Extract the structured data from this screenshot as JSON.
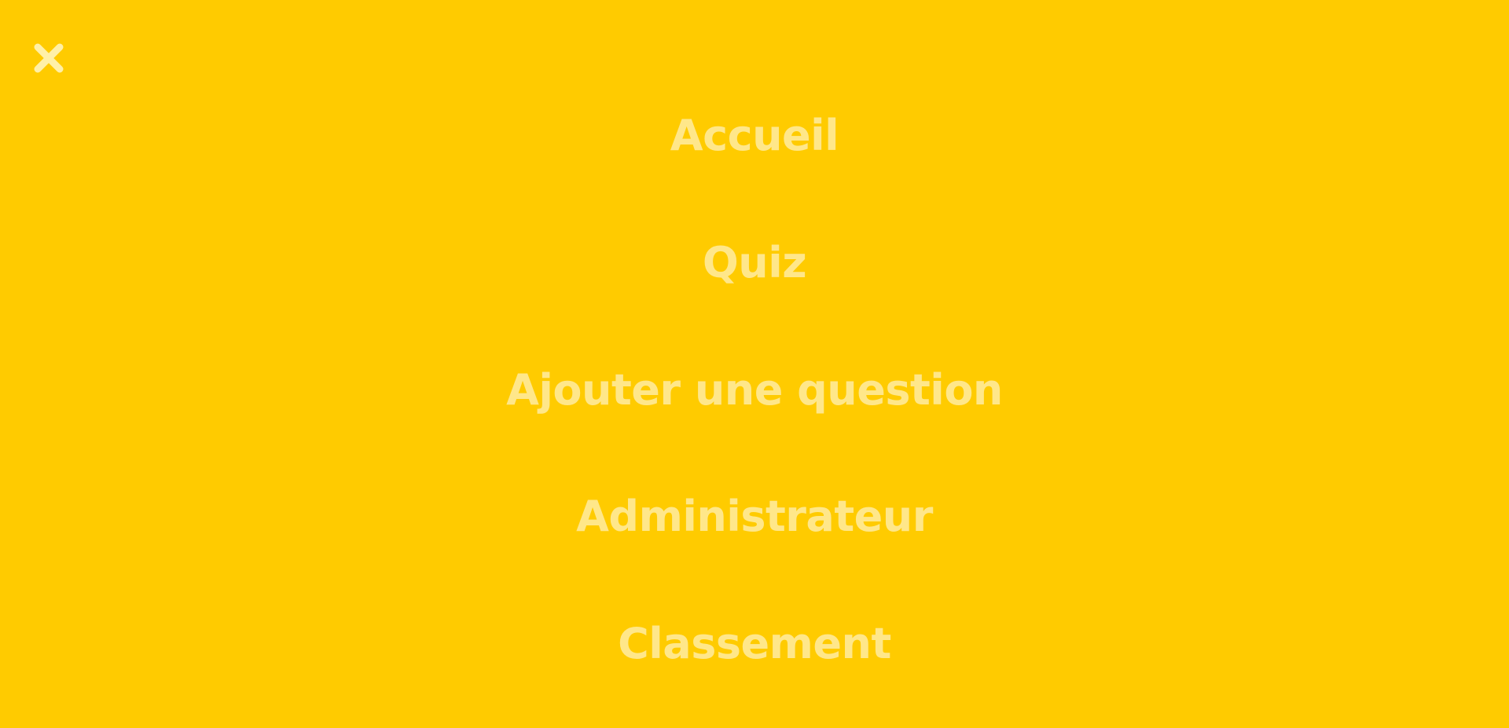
{
  "colors": {
    "background": "#FFCB00",
    "menu_text": "#FFE78A",
    "close_icon": "#FFF0A8"
  },
  "close_button": {
    "icon": "close-icon"
  },
  "menu": {
    "items": [
      {
        "label": "Accueil"
      },
      {
        "label": "Quiz"
      },
      {
        "label": "Ajouter une question"
      },
      {
        "label": "Administrateur"
      },
      {
        "label": "Classement"
      }
    ]
  }
}
